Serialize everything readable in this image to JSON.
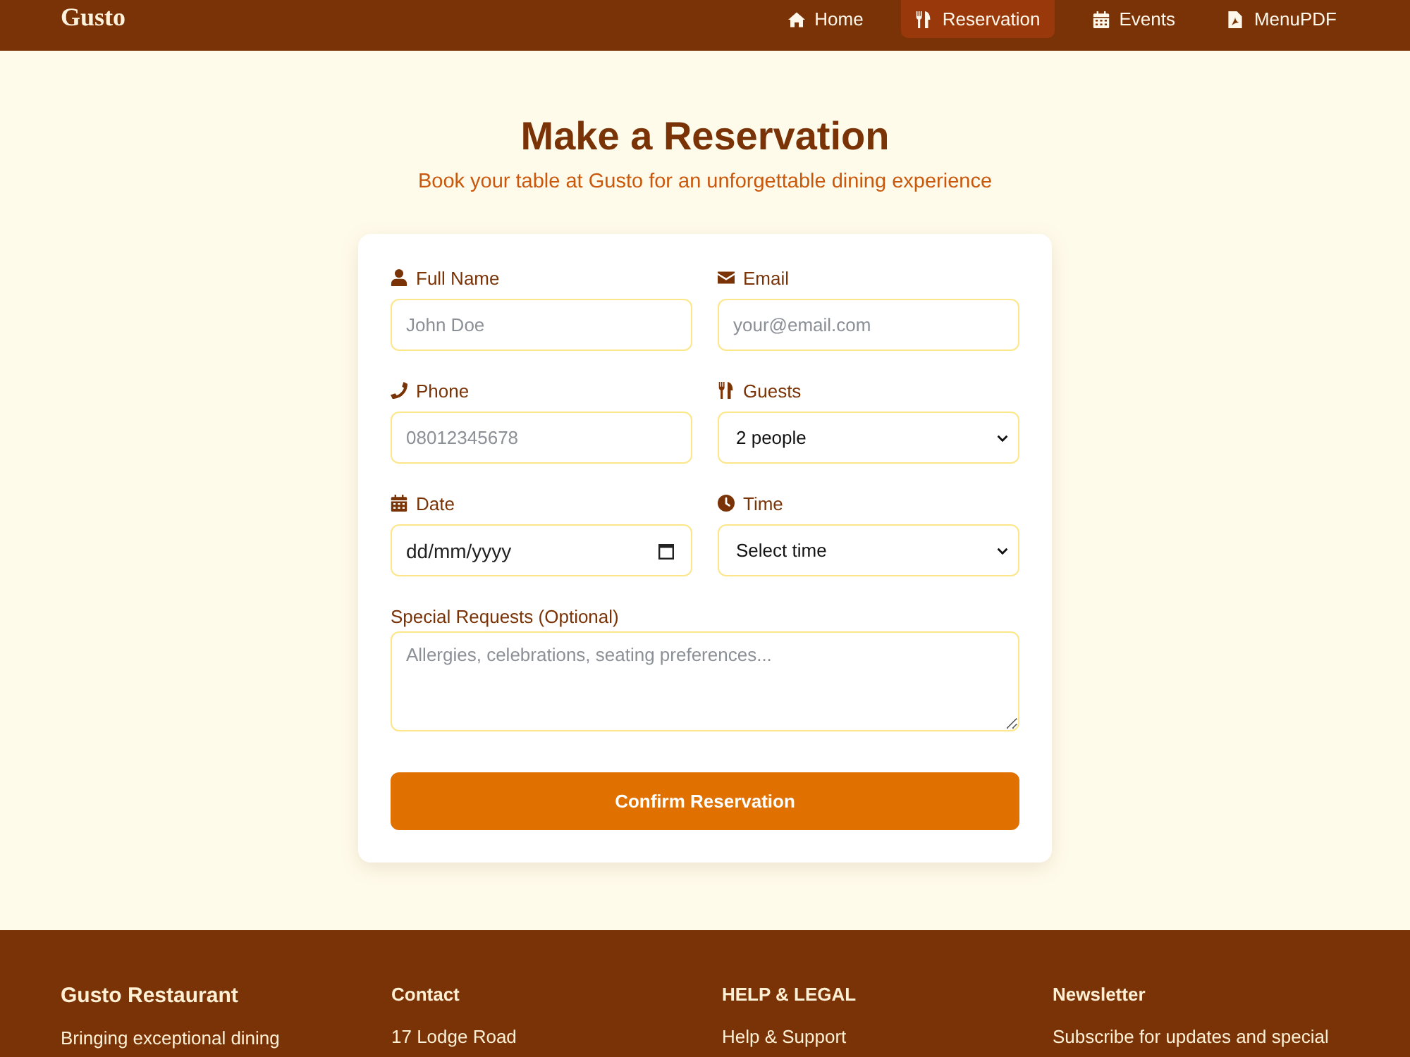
{
  "header": {
    "logo": "Gusto",
    "nav": [
      {
        "label": "Home",
        "selected": false
      },
      {
        "label": "Reservation",
        "selected": true
      },
      {
        "label": "Events",
        "selected": false
      },
      {
        "label": "MenuPDF",
        "selected": false
      }
    ]
  },
  "intro": {
    "title": "Make a Reservation",
    "subtitle": "Book your table at Gusto for an unforgettable dining experience"
  },
  "form": {
    "fields": [
      {
        "label": "Full Name",
        "kind": "text",
        "placeholder": "John Doe"
      },
      {
        "label": "Email",
        "kind": "text",
        "placeholder": "your@email.com"
      },
      {
        "label": "Phone",
        "kind": "text",
        "placeholder": "08012345678"
      },
      {
        "label": "Guests",
        "kind": "select",
        "value": "2 people"
      },
      {
        "label": "Date",
        "kind": "date",
        "placeholder": "dd/mm/yyyy"
      },
      {
        "label": "Time",
        "kind": "select",
        "value": "Select time"
      },
      {
        "label": "Special Requests (Optional)",
        "kind": "textarea",
        "placeholder": "Allergies, celebrations, seating preferences..."
      }
    ],
    "submit": "Confirm Reservation"
  },
  "footer": {
    "columns": [
      {
        "heading": "Gusto Restaurant",
        "lines": [
          "Bringing exceptional dining"
        ]
      },
      {
        "heading": "Contact",
        "lines": [
          "17 Lodge Road"
        ]
      },
      {
        "heading": "HELP & LEGAL",
        "links": [
          "Help & Support"
        ]
      },
      {
        "heading": "Newsletter",
        "lines": [
          "Subscribe for updates and special"
        ]
      }
    ]
  }
}
